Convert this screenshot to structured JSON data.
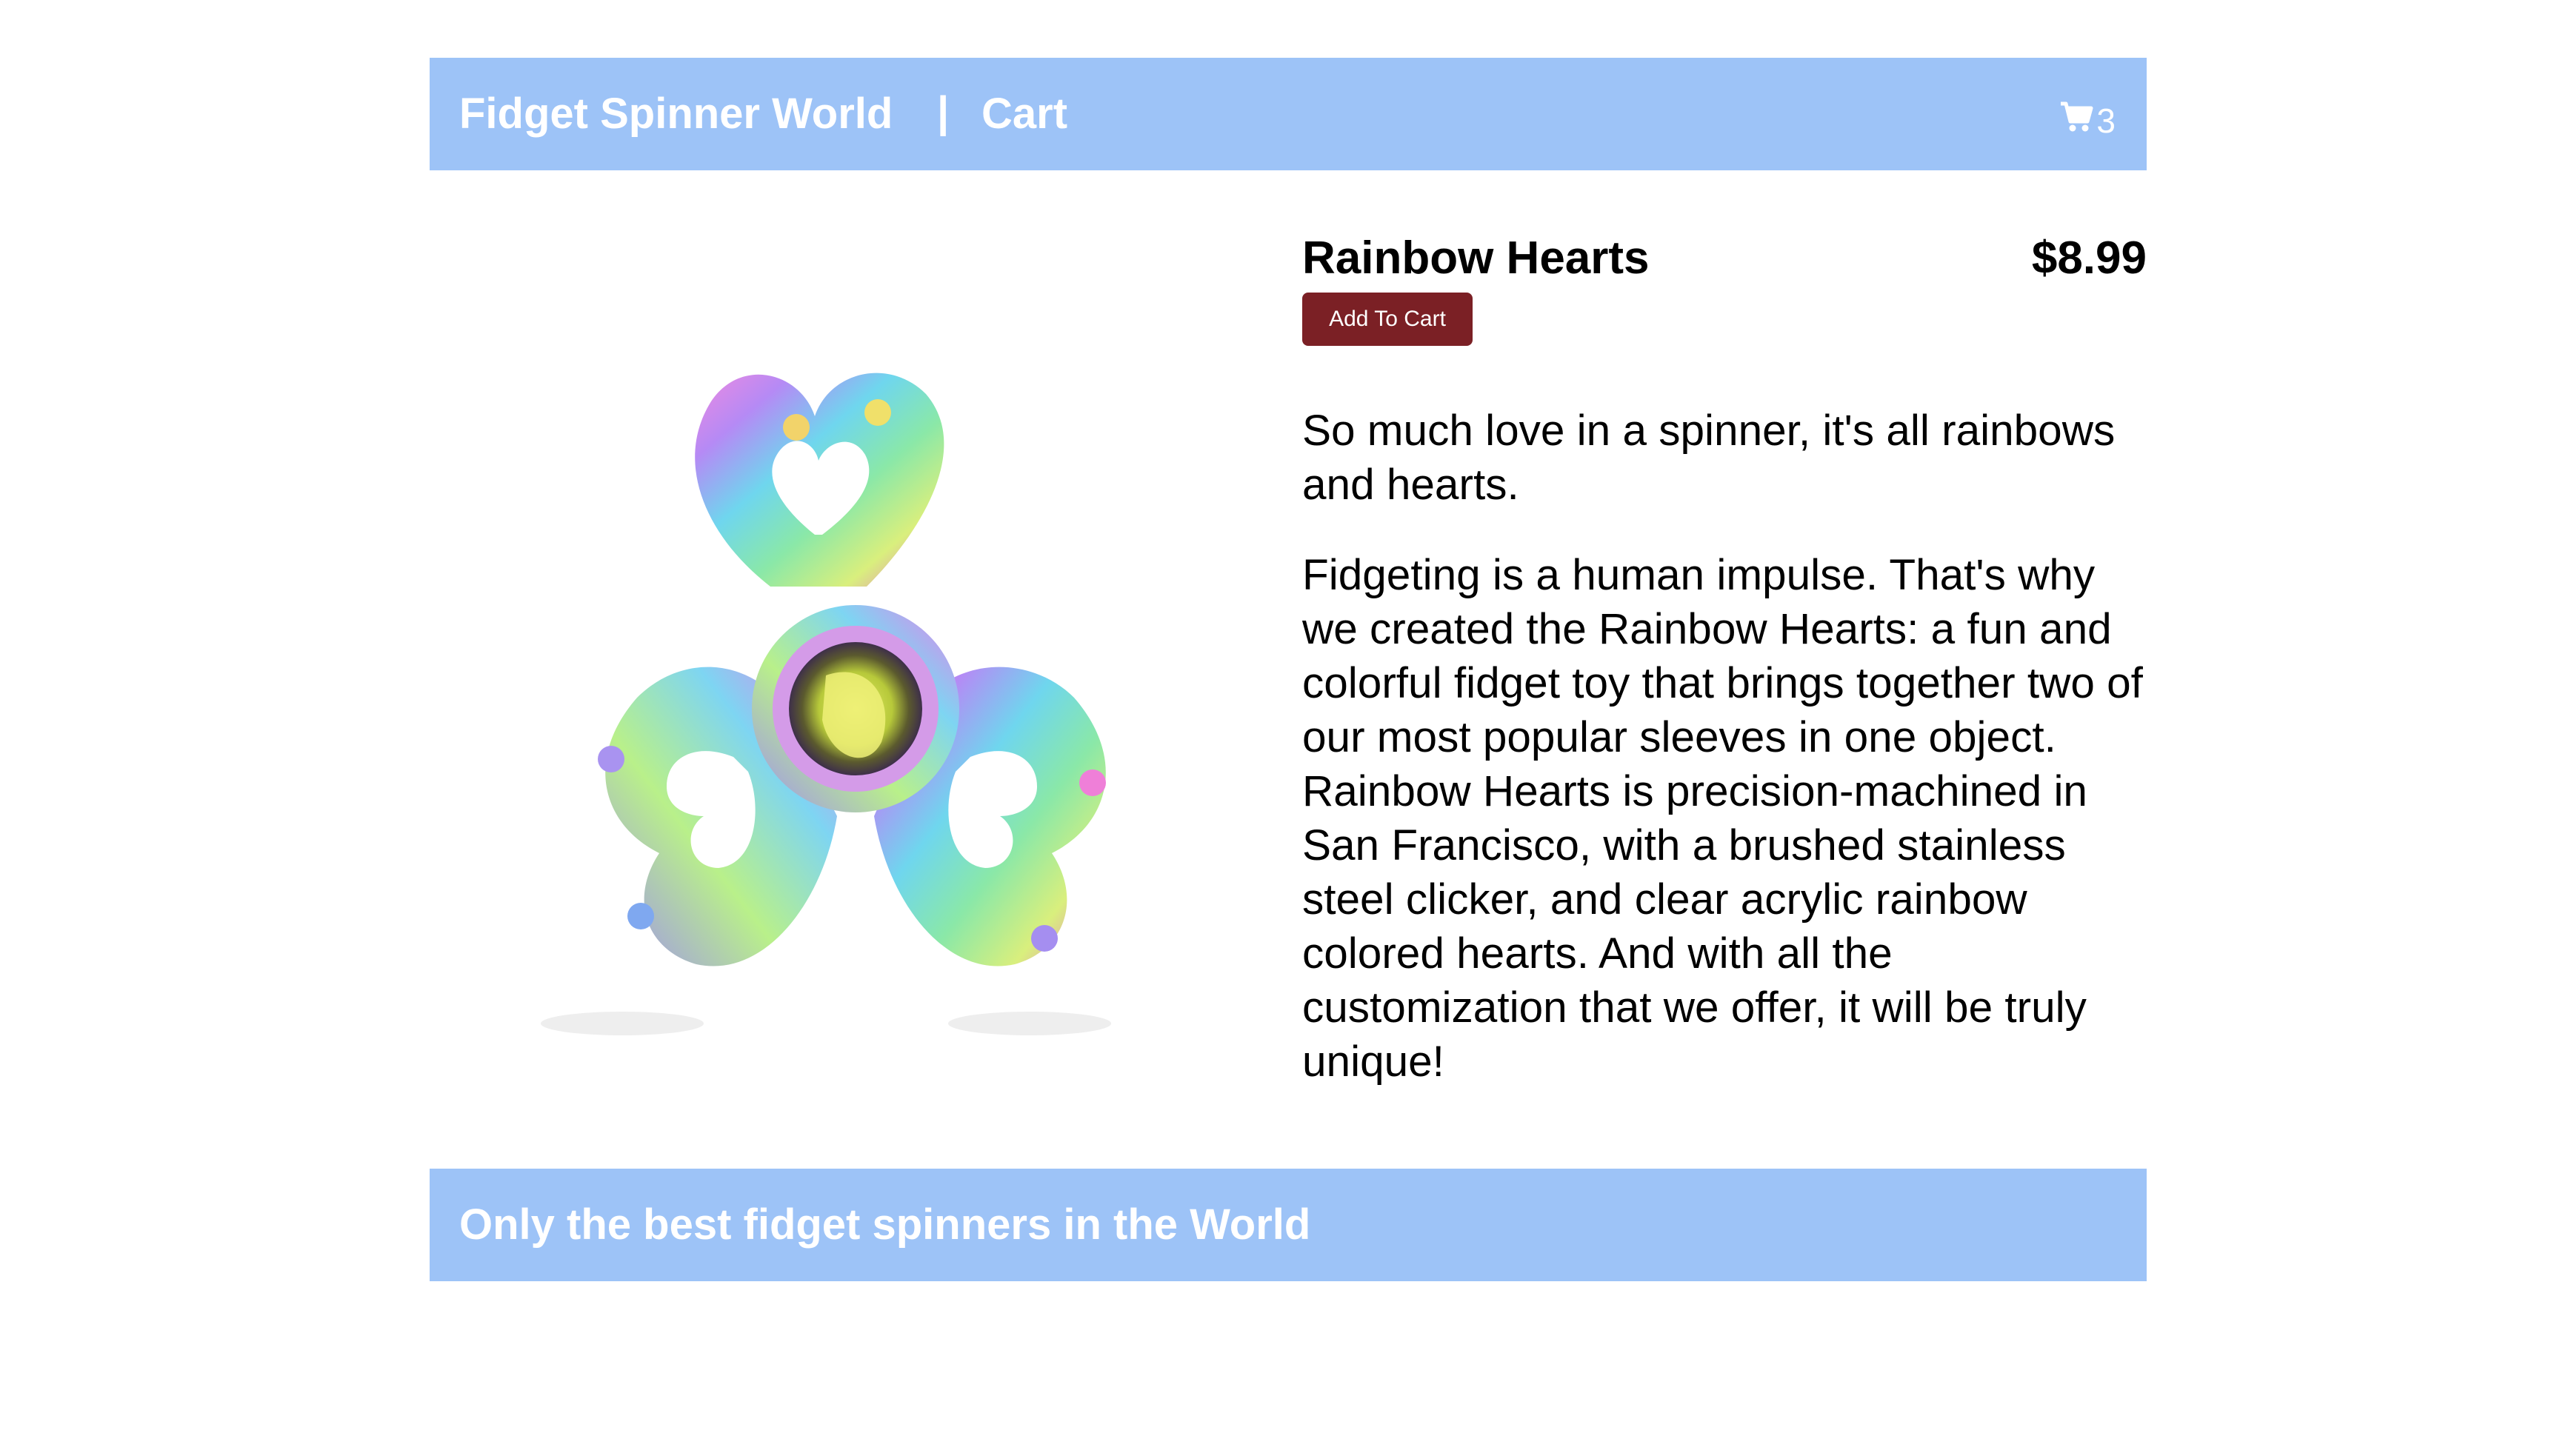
{
  "header": {
    "brand": "Fidget Spinner World",
    "separator": "|",
    "cart_link": "Cart",
    "cart_icon": "shopping-cart-icon",
    "cart_count": "3"
  },
  "product": {
    "name": "Rainbow Hearts",
    "price": "$8.99",
    "add_to_cart_label": "Add To Cart",
    "image_alt": "Rainbow Hearts fidget spinner",
    "description": [
      "So much love in a spinner, it's all rainbows and hearts.",
      "Fidgeting is a human impulse. That's why we created the Rainbow Hearts: a fun and colorful fidget toy that brings together two of our most popular sleeves in one object. Rainbow Hearts is precision-machined in San Francisco, with a brushed stainless steel clicker, and clear acrylic rainbow colored hearts. And with all the customization that we offer, it will be truly unique!"
    ]
  },
  "footer": {
    "tagline": "Only the best fidget spinners in the World"
  },
  "colors": {
    "bar": "#9dc3f7",
    "button": "#7b2025",
    "text": "#000000"
  }
}
